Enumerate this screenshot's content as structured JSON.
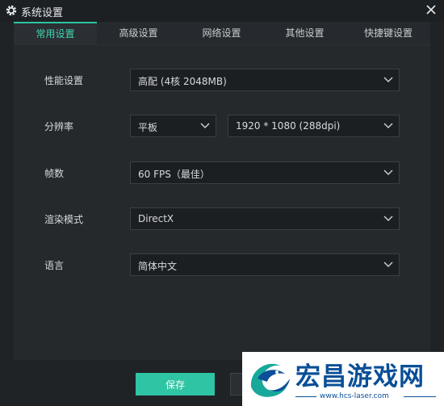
{
  "window": {
    "title": "系统设置"
  },
  "tabs": [
    {
      "label": "常用设置",
      "active": true
    },
    {
      "label": "高级设置",
      "active": false
    },
    {
      "label": "网络设置",
      "active": false
    },
    {
      "label": "其他设置",
      "active": false
    },
    {
      "label": "快捷键设置",
      "active": false
    }
  ],
  "settings": {
    "performance": {
      "label": "性能设置",
      "value": "高配 (4核 2048MB)"
    },
    "resolution": {
      "label": "分辨率",
      "device": "平板",
      "value": "1920 * 1080 (288dpi)"
    },
    "fps": {
      "label": "帧数",
      "value": "60 FPS（最佳）"
    },
    "render": {
      "label": "渲染模式",
      "value": "DirectX"
    },
    "language": {
      "label": "语言",
      "value": "简体中文"
    }
  },
  "footer": {
    "save_label": "保存"
  },
  "watermark": {
    "text": "宏昌游戏网",
    "url": "www.hcs-laser.com"
  },
  "colors": {
    "accent": "#2ec4a4",
    "background": "#1f2326",
    "panel": "#25292c",
    "watermark_blue": "#0a4f97"
  }
}
